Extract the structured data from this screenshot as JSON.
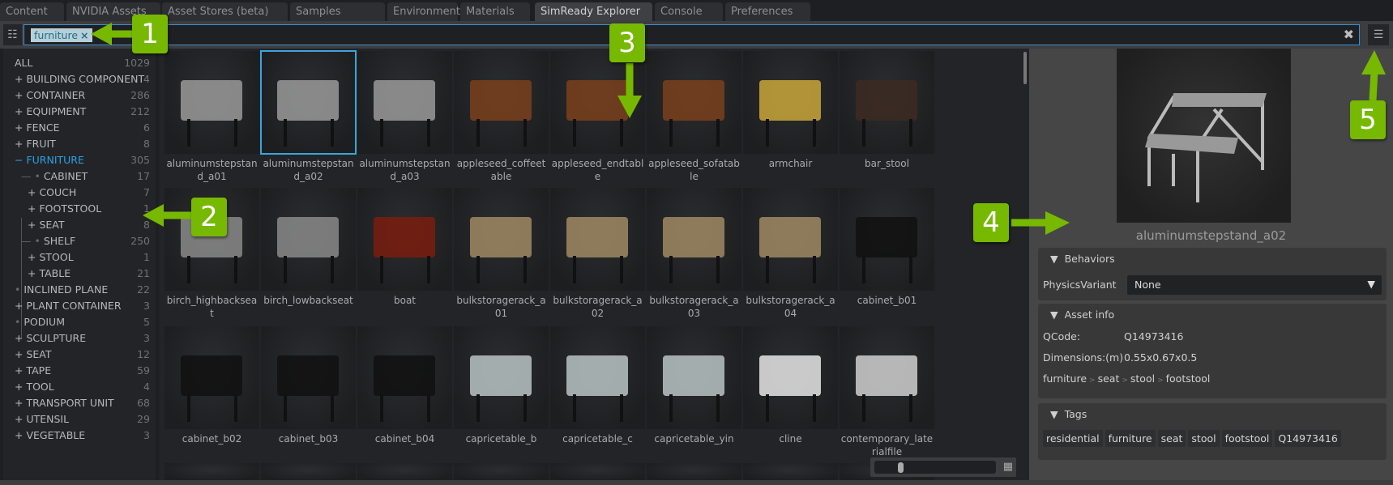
{
  "tabs": [
    "Content",
    "NVIDIA Assets",
    "Asset Stores (beta)",
    "Samples",
    "Environments",
    "Materials",
    "SimReady Explorer",
    "Console",
    "Preferences"
  ],
  "active_tab": "SimReady Explorer",
  "search": {
    "chip": "furniture",
    "chip_remove": "×",
    "clear": "✖"
  },
  "icons": {
    "tree_toggle": "☷",
    "options": "☰",
    "grid": "▦"
  },
  "tree": [
    {
      "label": "ALL",
      "count": "1029",
      "prefix": "",
      "depth": 0
    },
    {
      "label": "BUILDING COMPONENT",
      "count": "4",
      "prefix": "+",
      "depth": 0
    },
    {
      "label": "CONTAINER",
      "count": "286",
      "prefix": "+",
      "depth": 0
    },
    {
      "label": "EQUIPMENT",
      "count": "212",
      "prefix": "+",
      "depth": 0
    },
    {
      "label": "FENCE",
      "count": "6",
      "prefix": "+",
      "depth": 0
    },
    {
      "label": "FRUIT",
      "count": "8",
      "prefix": "+",
      "depth": 0
    },
    {
      "label": "FURNITURE",
      "count": "305",
      "prefix": "−",
      "depth": 0,
      "selected": true
    },
    {
      "label": "CABINET",
      "count": "17",
      "prefix": "•",
      "depth": 1
    },
    {
      "label": "COUCH",
      "count": "7",
      "prefix": "+",
      "depth": 1
    },
    {
      "label": "FOOTSTOOL",
      "count": "1",
      "prefix": "+",
      "depth": 1
    },
    {
      "label": "SEAT",
      "count": "8",
      "prefix": "+",
      "depth": 1
    },
    {
      "label": "SHELF",
      "count": "250",
      "prefix": "•",
      "depth": 1
    },
    {
      "label": "STOOL",
      "count": "1",
      "prefix": "+",
      "depth": 1
    },
    {
      "label": "TABLE",
      "count": "21",
      "prefix": "+",
      "depth": 1
    },
    {
      "label": "INCLINED PLANE",
      "count": "22",
      "prefix": "•",
      "depth": 0
    },
    {
      "label": "PLANT CONTAINER",
      "count": "3",
      "prefix": "+",
      "depth": 0
    },
    {
      "label": "PODIUM",
      "count": "5",
      "prefix": "•",
      "depth": 0
    },
    {
      "label": "SCULPTURE",
      "count": "3",
      "prefix": "+",
      "depth": 0
    },
    {
      "label": "SEAT",
      "count": "12",
      "prefix": "+",
      "depth": 0
    },
    {
      "label": "TAPE",
      "count": "59",
      "prefix": "+",
      "depth": 0
    },
    {
      "label": "TOOL",
      "count": "4",
      "prefix": "+",
      "depth": 0
    },
    {
      "label": "TRANSPORT UNIT",
      "count": "68",
      "prefix": "+",
      "depth": 0
    },
    {
      "label": "UTENSIL",
      "count": "29",
      "prefix": "+",
      "depth": 0
    },
    {
      "label": "VEGETABLE",
      "count": "3",
      "prefix": "+",
      "depth": 0
    }
  ],
  "assets": [
    {
      "name": "aluminumstepstand_a01",
      "tint": "#9a9a9a"
    },
    {
      "name": "aluminumstepstand_a02",
      "tint": "#9a9a9a",
      "selected": true
    },
    {
      "name": "aluminumstepstand_a03",
      "tint": "#9a9a9a"
    },
    {
      "name": "appleseed_coffeetable",
      "tint": "#7a3f1c"
    },
    {
      "name": "appleseed_endtable",
      "tint": "#7a3f1c"
    },
    {
      "name": "appleseed_sofatable",
      "tint": "#7a3f1c"
    },
    {
      "name": "armchair",
      "tint": "#c9a73a"
    },
    {
      "name": "bar_stool",
      "tint": "#3d2a22"
    },
    {
      "name": "birch_highbackseat",
      "tint": "#8a8a8a"
    },
    {
      "name": "birch_lowbackseat",
      "tint": "#8a8a8a"
    },
    {
      "name": "boat",
      "tint": "#7a1d0e"
    },
    {
      "name": "bulkstoragerack_a01",
      "tint": "#a08a64"
    },
    {
      "name": "bulkstoragerack_a02",
      "tint": "#a08a64"
    },
    {
      "name": "bulkstoragerack_a03",
      "tint": "#a08a64"
    },
    {
      "name": "bulkstoragerack_a04",
      "tint": "#a08a64"
    },
    {
      "name": "cabinet_b01",
      "tint": "#111111"
    },
    {
      "name": "cabinet_b02",
      "tint": "#111111"
    },
    {
      "name": "cabinet_b03",
      "tint": "#111111"
    },
    {
      "name": "cabinet_b04",
      "tint": "#111111"
    },
    {
      "name": "capricetable_b",
      "tint": "#b8c4c4"
    },
    {
      "name": "capricetable_c",
      "tint": "#b8c4c4"
    },
    {
      "name": "capricetable_yin",
      "tint": "#b8c4c4"
    },
    {
      "name": "cline",
      "tint": "#e6e6e6"
    },
    {
      "name": "contemporary_laterialfile",
      "tint": "#d0d0d0"
    }
  ],
  "details": {
    "name": "aluminumstepstand_a02",
    "behaviors": {
      "title": "Behaviors",
      "label": "PhysicsVariant",
      "value": "None",
      "arrow": "▼"
    },
    "asset_info": {
      "title": "Asset info",
      "qcode_label": "QCode:",
      "qcode": "Q14973416",
      "dims_label": "Dimensions:(m)",
      "dims": "0.55x0.67x0.5",
      "breadcrumb": [
        "furniture",
        "seat",
        "stool",
        "footstool"
      ],
      "sep": ">"
    },
    "tags": {
      "title": "Tags",
      "items": [
        "residential",
        "furniture",
        "seat",
        "stool",
        "footstool",
        "Q14973416"
      ]
    },
    "collapse": "▼"
  },
  "callouts": [
    "1",
    "2",
    "3",
    "4",
    "5"
  ],
  "colors": {
    "accent": "#3f8fcf",
    "callout": "#76b900",
    "selected": "#2c9fe6"
  }
}
